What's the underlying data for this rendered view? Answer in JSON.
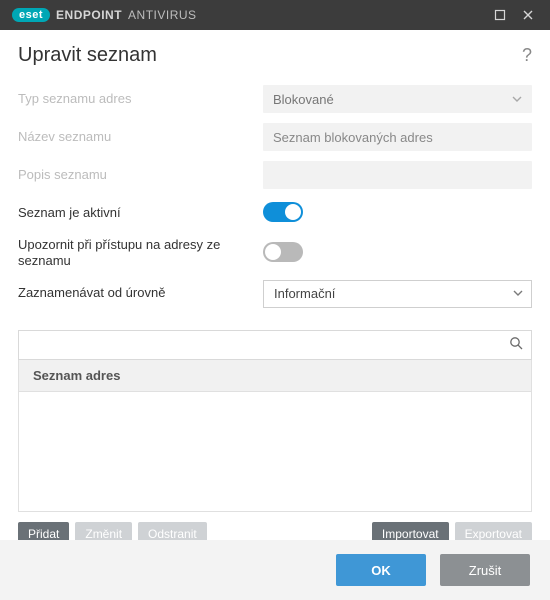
{
  "titlebar": {
    "brand_badge": "eset",
    "brand_head": "ENDPOINT",
    "brand_tail": "ANTIVIRUS"
  },
  "header": {
    "title": "Upravit seznam",
    "help": "?"
  },
  "form": {
    "type_label": "Typ seznamu adres",
    "type_value": "Blokované",
    "name_label": "Název seznamu",
    "name_value": "Seznam blokovaných adres",
    "desc_label": "Popis seznamu",
    "desc_value": "",
    "active_label": "Seznam je aktivní",
    "active_on": true,
    "notify_label": "Upozornit při přístupu na adresy ze seznamu",
    "notify_on": false,
    "log_label": "Zaznamenávat od úrovně",
    "log_value": "Informační"
  },
  "list": {
    "search_value": "",
    "header": "Seznam adres",
    "actions": {
      "add": "Přidat",
      "edit": "Změnit",
      "remove": "Odstranit",
      "import": "Importovat",
      "export": "Exportovat"
    }
  },
  "footer": {
    "ok": "OK",
    "cancel": "Zrušit"
  }
}
